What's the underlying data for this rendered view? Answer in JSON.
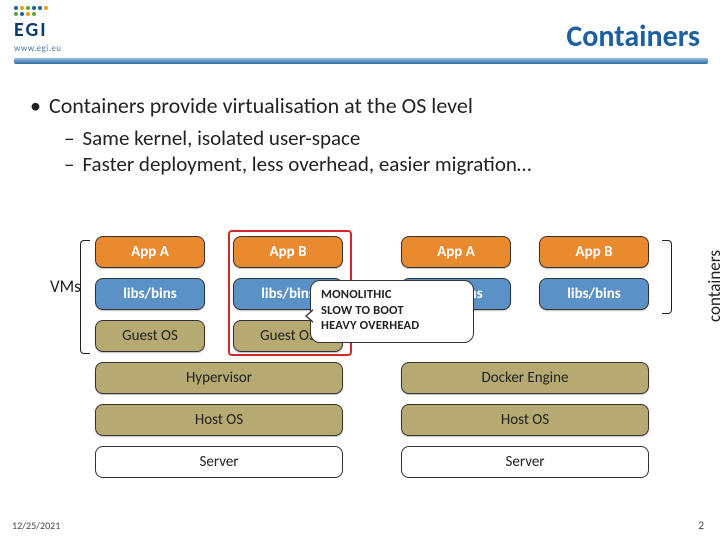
{
  "header": {
    "logo_text": "EGI",
    "logo_sub": "www.egi.eu",
    "title": "Containers"
  },
  "bullets": {
    "lvl1": "Containers provide virtualisation at the OS level",
    "lvl2a": "Same kernel, isolated user-space",
    "lvl2b": "Faster deployment, less overhead, easier migration…"
  },
  "labels": {
    "vms": "VMs",
    "containers": "containers"
  },
  "vm_stack": {
    "apps": [
      "App A",
      "App B"
    ],
    "libs": [
      "libs/bins",
      "libs/bins"
    ],
    "guest": [
      "Guest OS",
      "Guest OS"
    ],
    "hypervisor": "Hypervisor",
    "host_os": "Host OS",
    "server": "Server"
  },
  "container_stack": {
    "apps": [
      "App A",
      "App B"
    ],
    "libs": [
      "libs/bins",
      "libs/bins"
    ],
    "engine": "Docker Engine",
    "host_os": "Host OS",
    "server": "Server"
  },
  "callout": {
    "l1": "MONOLITHIC",
    "l2": "SLOW TO BOOT",
    "l3": "HEAVY OVERHEAD"
  },
  "footer": {
    "date": "12/25/2021",
    "page": "2"
  }
}
